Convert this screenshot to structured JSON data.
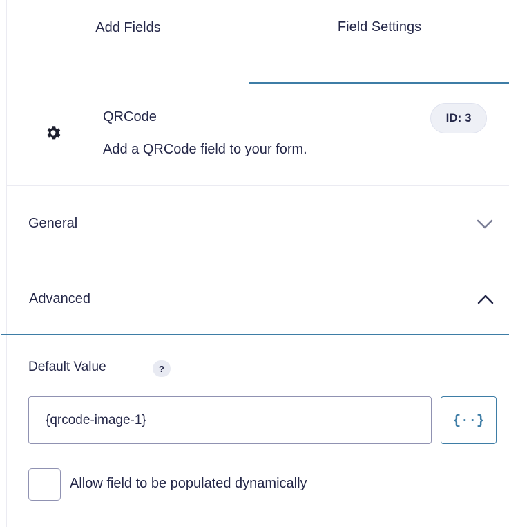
{
  "tabs": {
    "add_fields": "Add Fields",
    "field_settings": "Field Settings"
  },
  "field": {
    "icon": "gear-icon",
    "title": "QRCode",
    "description": "Add a QRCode field to your form.",
    "id_badge": "ID: 3"
  },
  "sections": {
    "general": {
      "label": "General",
      "state": "collapsed"
    },
    "advanced": {
      "label": "Advanced",
      "state": "expanded"
    }
  },
  "advanced": {
    "default_value_label": "Default Value",
    "help_icon": "?",
    "default_value": "{qrcode-image-1}",
    "merge_tag_button": "{··}",
    "dynamic_population_label": "Allow field to be populated dynamically",
    "dynamic_population_checked": false
  },
  "colors": {
    "accent": "#3e7da6",
    "text": "#242748",
    "border": "#9092b2",
    "badge_bg": "#eef0f6"
  }
}
